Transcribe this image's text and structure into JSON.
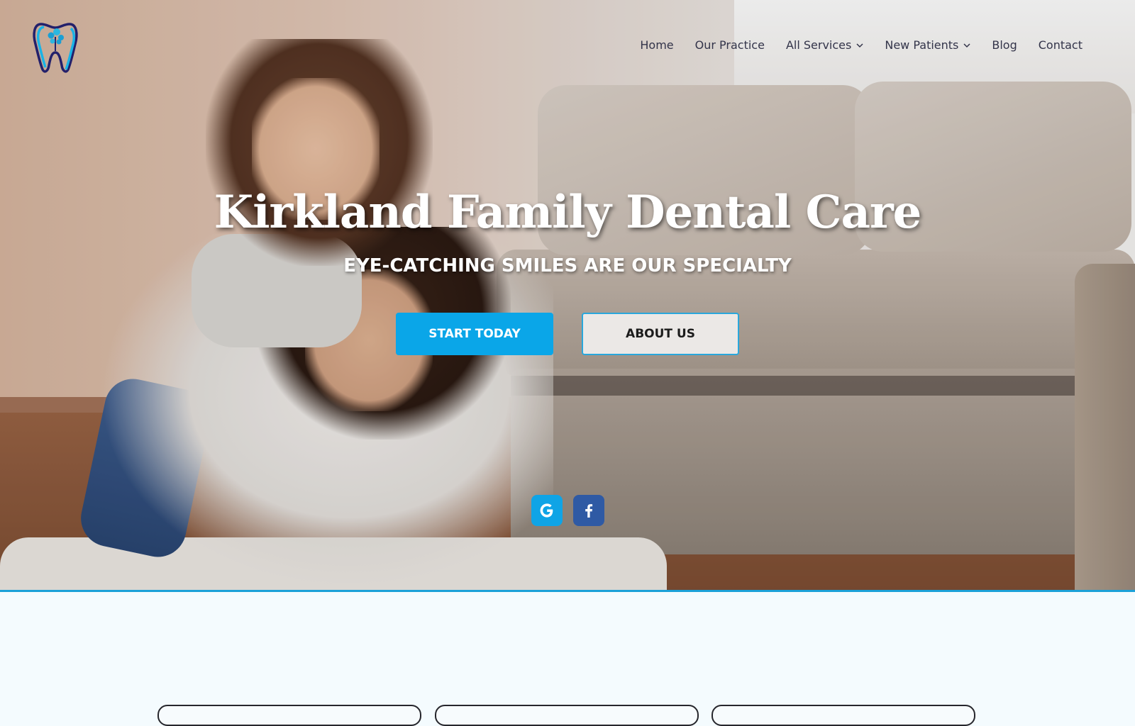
{
  "site": {
    "logo_icon": "tooth-tree-logo-icon"
  },
  "nav": {
    "items": [
      {
        "label": "Home",
        "has_dropdown": false
      },
      {
        "label": "Our Practice",
        "has_dropdown": false
      },
      {
        "label": "All Services",
        "has_dropdown": true
      },
      {
        "label": "New Patients",
        "has_dropdown": true
      },
      {
        "label": "Blog",
        "has_dropdown": false
      },
      {
        "label": "Contact",
        "has_dropdown": false
      }
    ]
  },
  "hero": {
    "title": "Kirkland Family Dental Care",
    "subtitle": "EYE-CATCHING SMILES ARE OUR SPECIALTY",
    "primary_button": "START TODAY",
    "secondary_button": "ABOUT US"
  },
  "social": {
    "google_icon": "google-icon",
    "facebook_icon": "facebook-icon"
  },
  "colors": {
    "accent": "#0aa6e8",
    "facebook": "#2f5aa4",
    "nav_text": "#33344a",
    "section_bg": "#f4fbfe",
    "divider": "#1ba0d8"
  }
}
